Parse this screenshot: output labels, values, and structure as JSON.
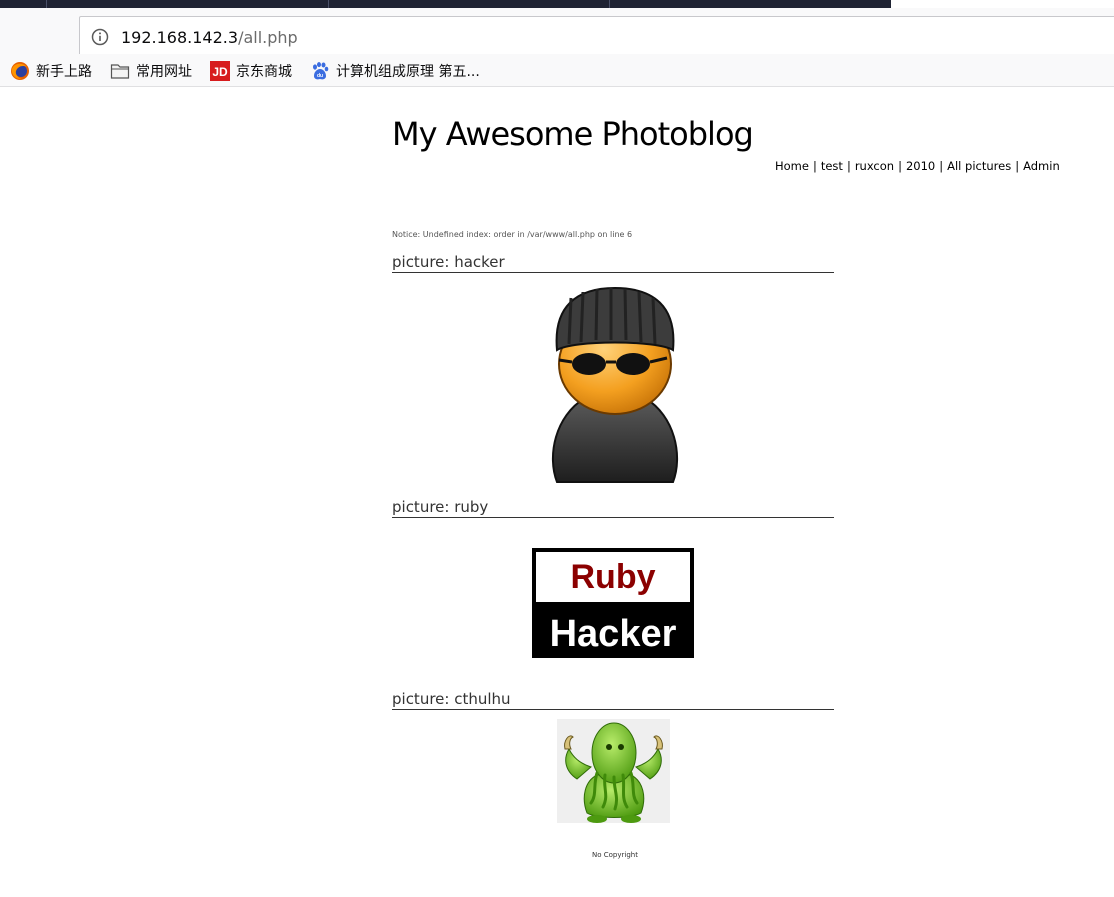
{
  "browser": {
    "url_host": "192.168.142.3",
    "url_path": "/all.php",
    "bookmarks": [
      {
        "label": "新手上路",
        "icon": "firefox-icon"
      },
      {
        "label": "常用网址",
        "icon": "folder-icon"
      },
      {
        "label": "京东商城",
        "icon": "jd-icon"
      },
      {
        "label": "计算机组成原理 第五...",
        "icon": "baidu-paw-icon"
      }
    ]
  },
  "site": {
    "title": "My Awesome Photoblog",
    "nav": [
      "Home",
      "test",
      "ruxcon",
      "2010",
      "All pictures",
      "Admin"
    ],
    "nav_separator": "|"
  },
  "notice": "Notice: Undefined index: order in /var/www/all.php on line 6",
  "pictures": [
    {
      "title": "picture: hacker",
      "image": "hacker-avatar"
    },
    {
      "title": "picture: ruby",
      "image": "ruby-hacker-logo",
      "logo_text": [
        "Ruby",
        "Hacker"
      ]
    },
    {
      "title": "picture: cthulhu",
      "image": "cthulhu-cartoon"
    }
  ],
  "footer": "No Copyright",
  "colors": {
    "tabstrip": "#1f2333",
    "toolbar": "#f9f9fa",
    "ruby_red": "#8b0000"
  }
}
